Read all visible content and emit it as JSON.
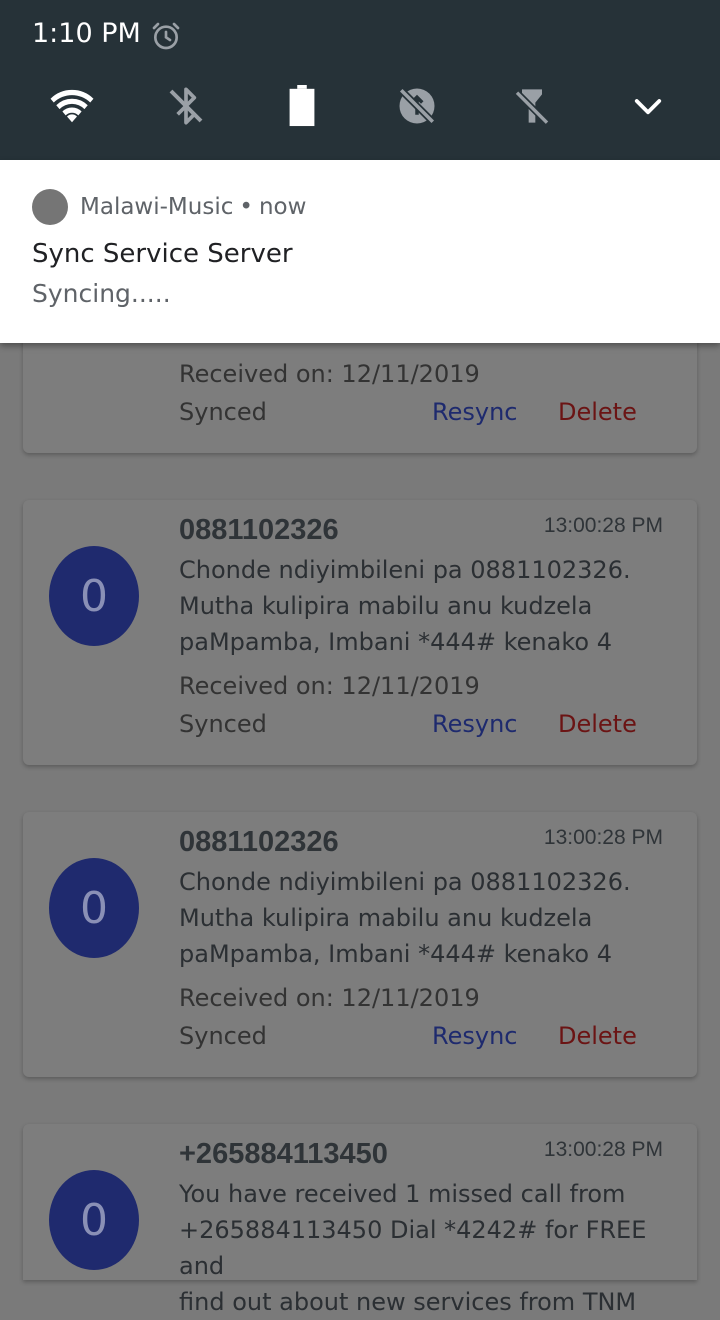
{
  "status_bar": {
    "time": "1:10 PM"
  },
  "quick_settings": {
    "icons": [
      "wifi-icon",
      "bluetooth-off-icon",
      "battery-icon",
      "data-saver-icon",
      "flashlight-off-icon",
      "chevron-down-icon"
    ]
  },
  "notification": {
    "app_name": "Malawi-Music",
    "separator": "•",
    "when": "now",
    "title": "Sync Service Server",
    "text": "Syncing....."
  },
  "messages": [
    {
      "received": "Received on: 12/11/2019",
      "status": "Synced",
      "resync": "Resync",
      "delete": "Delete"
    },
    {
      "avatar": "0",
      "sender": "0881102326",
      "time": "13:00:28 PM",
      "lines": [
        "Chonde ndiyimbileni pa 0881102326.",
        "Mutha kulipira mabilu anu kudzela",
        "paMpamba, Imbani *444# kenako 4"
      ],
      "received": "Received on: 12/11/2019",
      "status": "Synced",
      "resync": "Resync",
      "delete": "Delete"
    },
    {
      "avatar": "0",
      "sender": "0881102326",
      "time": "13:00:28 PM",
      "lines": [
        "Chonde ndiyimbileni pa 0881102326.",
        "Mutha kulipira mabilu anu kudzela",
        "paMpamba, Imbani *444# kenako 4"
      ],
      "received": "Received on: 12/11/2019",
      "status": "Synced",
      "resync": "Resync",
      "delete": "Delete"
    },
    {
      "avatar": "0",
      "sender": "+265884113450",
      "time": "13:00:28 PM",
      "lines": [
        "You have received 1 missed call from",
        "+265884113450 Dial *4242# for FREE and",
        "find out about new services from TNM"
      ]
    }
  ],
  "colors": {
    "shade_bg": "#263238",
    "avatar_bg": "#1f2a6e",
    "resync": "#1e2a6e",
    "delete": "#6b1414"
  }
}
